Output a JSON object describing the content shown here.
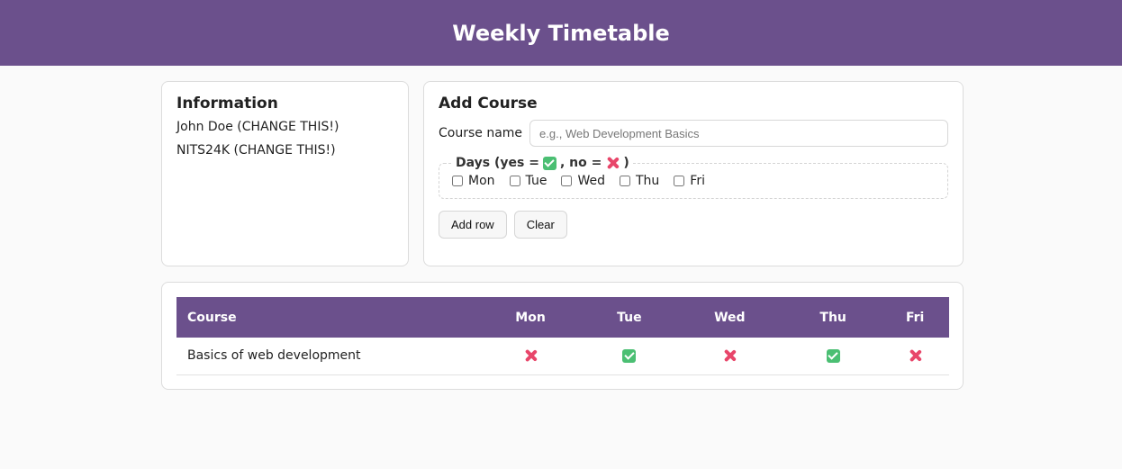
{
  "header": {
    "title": "Weekly Timetable"
  },
  "info": {
    "heading": "Information",
    "name": "John Doe (CHANGE THIS!)",
    "id": "NITS24K (CHANGE THIS!)"
  },
  "add_course": {
    "heading": "Add Course",
    "course_name_label": "Course name",
    "course_name_placeholder": "e.g., Web Development Basics",
    "course_name_value": "",
    "days_legend_prefix": "Days (yes =",
    "days_legend_mid": ", no =",
    "days_legend_suffix": ")",
    "days": [
      {
        "label": "Mon",
        "checked": false
      },
      {
        "label": "Tue",
        "checked": false
      },
      {
        "label": "Wed",
        "checked": false
      },
      {
        "label": "Thu",
        "checked": false
      },
      {
        "label": "Fri",
        "checked": false
      }
    ],
    "add_row_label": "Add row",
    "clear_label": "Clear"
  },
  "timetable": {
    "headers": [
      "Course",
      "Mon",
      "Tue",
      "Wed",
      "Thu",
      "Fri"
    ],
    "rows": [
      {
        "course": "Basics of web development",
        "days": [
          "no",
          "yes",
          "no",
          "yes",
          "no"
        ]
      }
    ]
  },
  "icons": {
    "yes": "check-box-icon",
    "no": "cross-mark-icon"
  },
  "colors": {
    "accent": "#6b508c",
    "yes": "#4bbf73",
    "no": "#e8466a"
  }
}
